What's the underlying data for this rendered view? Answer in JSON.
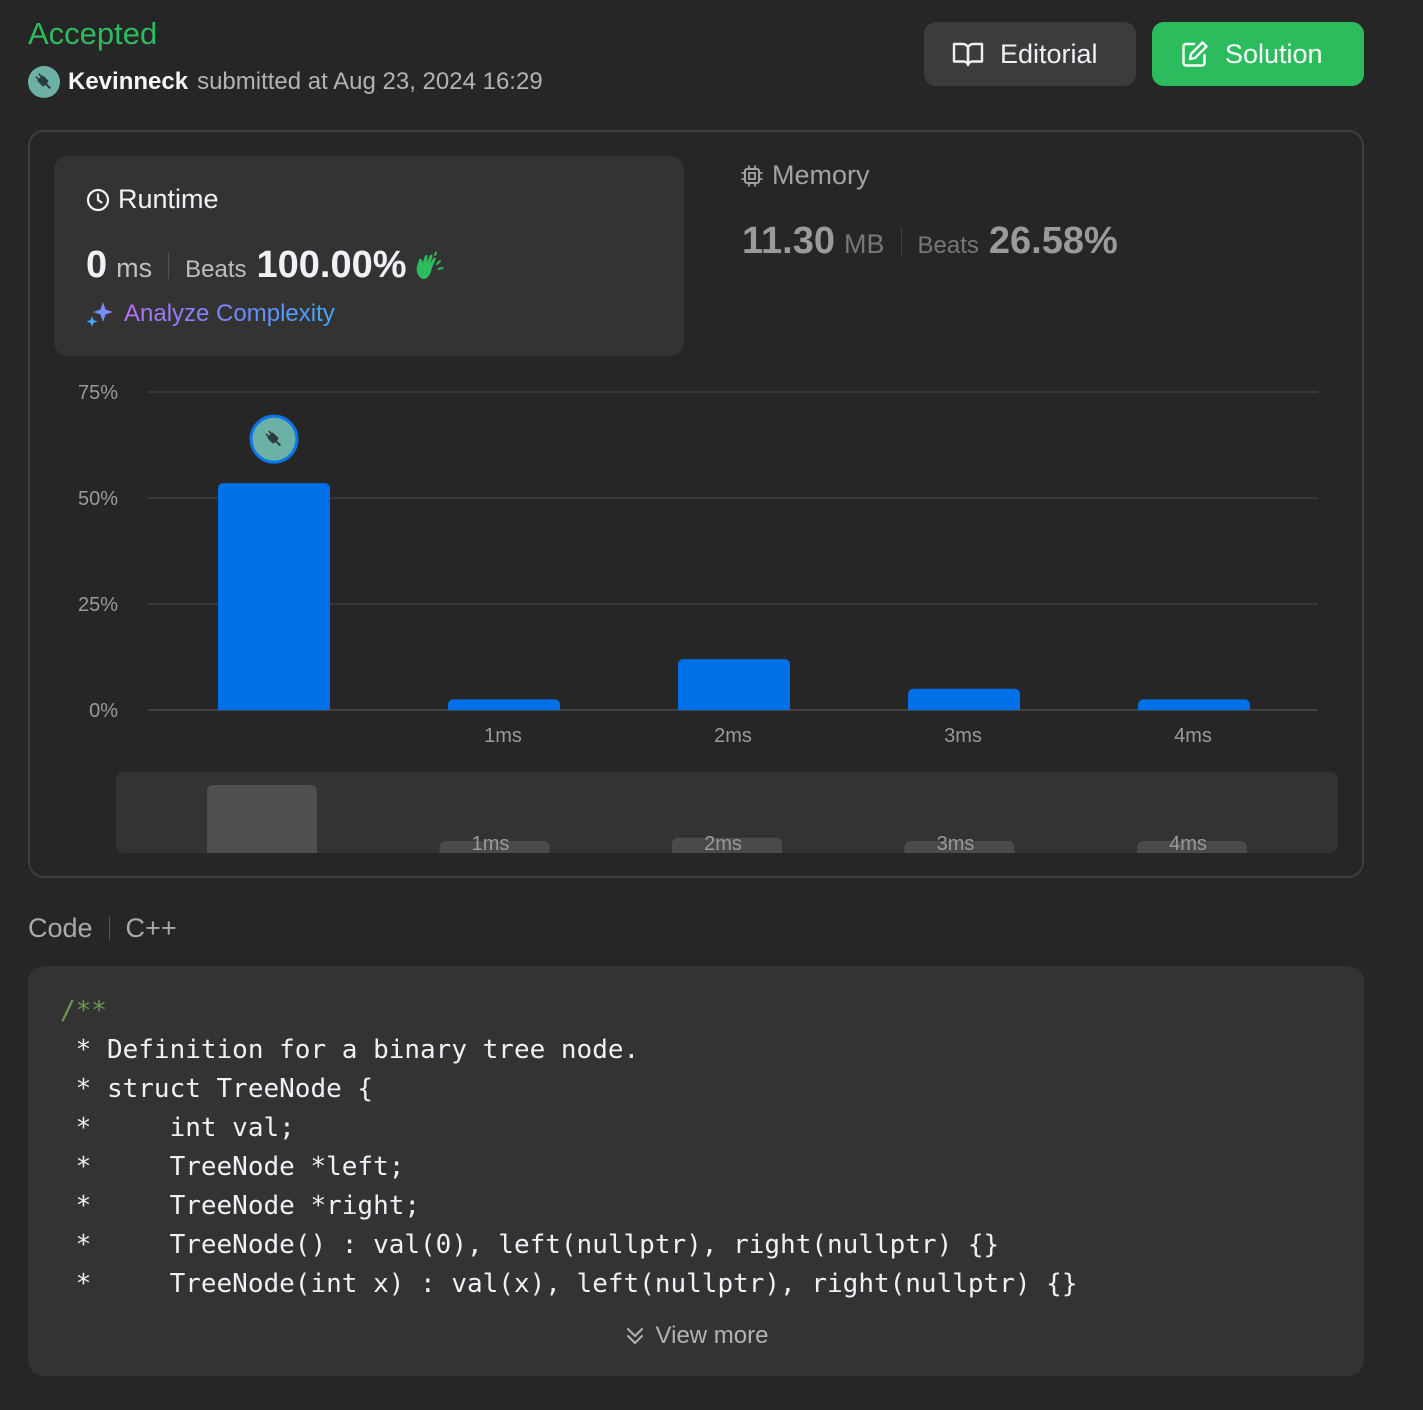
{
  "header": {
    "status": "Accepted",
    "username": "Kevinneck",
    "submitted_text": "submitted at Aug 23, 2024 16:29",
    "editorial_label": "Editorial",
    "solution_label": "Solution",
    "solution_color": "#2cbb5d",
    "status_color": "#2cbb5d"
  },
  "runtime": {
    "title": "Runtime",
    "value": "0",
    "unit": "ms",
    "beats_label": "Beats",
    "beats_value": "100.00%",
    "analyze_label": "Analyze Complexity",
    "icon": "clock-icon",
    "badge_icon": "clap-icon"
  },
  "memory": {
    "title": "Memory",
    "value": "11.30",
    "unit": "MB",
    "beats_label": "Beats",
    "beats_value": "26.58%",
    "icon": "chip-icon"
  },
  "chart_data": {
    "type": "bar",
    "categories": [
      "",
      "1ms",
      "2ms",
      "3ms",
      "4ms"
    ],
    "values": [
      53.5,
      2.5,
      12,
      5,
      2.5
    ],
    "y_ticks": [
      0,
      25,
      50,
      75
    ],
    "y_tick_labels": [
      "0%",
      "25%",
      "50%",
      "75%"
    ],
    "ylim": [
      0,
      75
    ],
    "grid": true,
    "bar_color": "#0070e8",
    "highlight_index": 0,
    "title": "",
    "xlabel": "",
    "ylabel": ""
  },
  "code": {
    "label": "Code",
    "language": "C++",
    "first_line": "/**",
    "lines": [
      " * Definition for a binary tree node.",
      " * struct TreeNode {",
      " *     int val;",
      " *     TreeNode *left;",
      " *     TreeNode *right;",
      " *     TreeNode() : val(0), left(nullptr), right(nullptr) {}",
      " *     TreeNode(int x) : val(x), left(nullptr), right(nullptr) {}"
    ],
    "view_more_label": "View more"
  }
}
